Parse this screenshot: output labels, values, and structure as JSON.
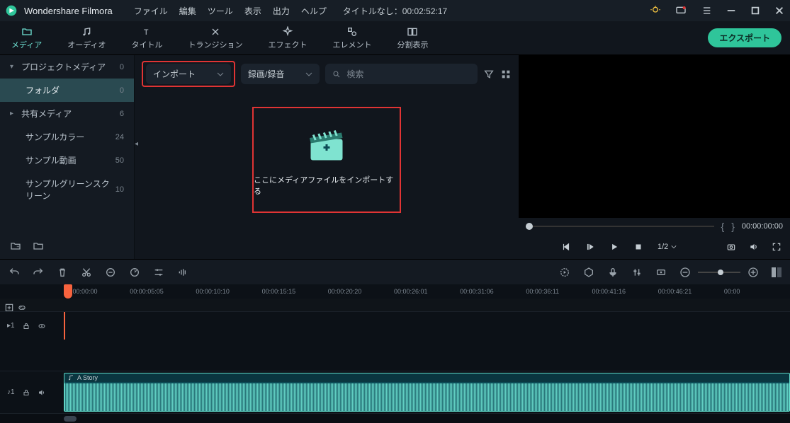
{
  "app_title": "Wondershare Filmora",
  "menus": [
    "ファイル",
    "編集",
    "ツール",
    "表示",
    "出力",
    "ヘルプ"
  ],
  "doc_title": "タイトルなし：00:02:52:17",
  "tabs": [
    {
      "label": "メディア"
    },
    {
      "label": "オーディオ"
    },
    {
      "label": "タイトル"
    },
    {
      "label": "トランジション"
    },
    {
      "label": "エフェクト"
    },
    {
      "label": "エレメント"
    },
    {
      "label": "分割表示"
    }
  ],
  "export_label": "エクスポート",
  "sidebar": {
    "items": [
      {
        "name": "プロジェクトメディア",
        "count": "0",
        "chev": "▾"
      },
      {
        "name": "フォルダ",
        "count": "0"
      },
      {
        "name": "共有メディア",
        "count": "6",
        "chev": "▸"
      },
      {
        "name": "サンプルカラー",
        "count": "24"
      },
      {
        "name": "サンプル動画",
        "count": "50"
      },
      {
        "name": "サンプルグリーンスクリーン",
        "count": "10"
      }
    ]
  },
  "media_toolbar": {
    "import_label": "インポート",
    "record_label": "録画/録音",
    "search_placeholder": "検索"
  },
  "drop_text": "ここにメディアファイルをインポートする",
  "preview": {
    "timecode": "00:00:00:00",
    "ratio": "1/2"
  },
  "ruler_marks": [
    "00:00:00:00",
    "00:00:05:05",
    "00:00:10:10",
    "00:00:15:15",
    "00:00:20:20",
    "00:00:26:01",
    "00:00:31:06",
    "00:00:36:11",
    "00:00:41:16",
    "00:00:46:21",
    "00:00"
  ],
  "tracks": {
    "video_label": "▸1",
    "audio_label": "♪1",
    "audio_clip_name": "A Story"
  }
}
